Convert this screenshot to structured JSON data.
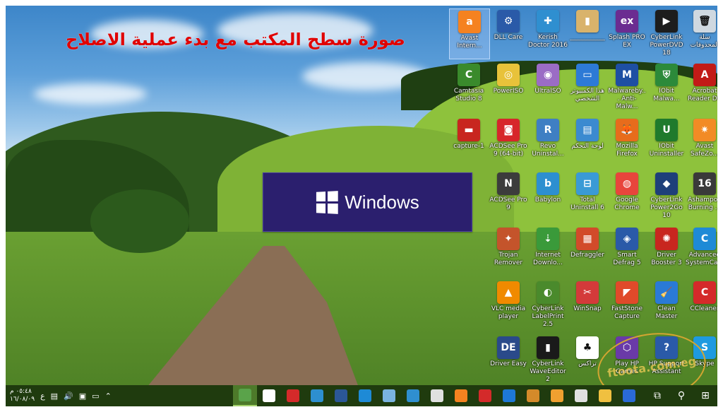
{
  "overlay_title": "صورة سطح المكتب مع بدء عملية الاصلاح",
  "banner": {
    "text": "Windows"
  },
  "desktop_icons": [
    {
      "label": "Avast Intern...",
      "color": "#f58220",
      "glyph": "a",
      "selected": true
    },
    {
      "label": "DLL Care",
      "color": "#2a5aa8",
      "glyph": "⚙"
    },
    {
      "label": "Kerish Doctor 2016",
      "color": "#2f8fd0",
      "glyph": "✚"
    },
    {
      "label": "___________",
      "color": "#d9b36b",
      "glyph": "▮"
    },
    {
      "label": "Splash PRO EX",
      "color": "#6b2c91",
      "glyph": "ex"
    },
    {
      "label": "CyberLink PowerDVD 18",
      "color": "#1d1d1d",
      "glyph": "▶"
    },
    {
      "label": "سلة المحذوفات",
      "color": "#cfd8e0",
      "glyph": "🗑"
    },
    {
      "label": "Camtasia Studio 8",
      "color": "#3a8a2c",
      "glyph": "C"
    },
    {
      "label": "PowerISO",
      "color": "#e8c23a",
      "glyph": "◎"
    },
    {
      "label": "UltraISO",
      "color": "#9b6cc5",
      "glyph": "◉"
    },
    {
      "label": "هذا الكمبيوتر الشخصي",
      "color": "#2d7ad6",
      "glyph": "▭"
    },
    {
      "label": "Malwareby... Anti-Malw...",
      "color": "#1e4fa3",
      "glyph": "M"
    },
    {
      "label": "IObit Malwa...",
      "color": "#2c8a3a",
      "glyph": "⛨"
    },
    {
      "label": "Acrobat Reader DC",
      "color": "#c21b17",
      "glyph": "A"
    },
    {
      "label": "capture-1",
      "color": "#c8261f",
      "glyph": "▬"
    },
    {
      "label": "ACDSee Pro 9 (64-bit)",
      "color": "#d7262b",
      "glyph": "◙"
    },
    {
      "label": "Revo Uninstal...",
      "color": "#3f7fc3",
      "glyph": "R"
    },
    {
      "label": "لوحة التحكم",
      "color": "#3b8ad0",
      "glyph": "▤"
    },
    {
      "label": "Mozilla Firefox",
      "color": "#e76c1c",
      "glyph": "🦊"
    },
    {
      "label": "IObit Uninstaller",
      "color": "#1f7a2c",
      "glyph": "U"
    },
    {
      "label": "Avast SafeZo...",
      "color": "#f28b25",
      "glyph": "✷"
    },
    {
      "label": "ACDSee Pro 9",
      "color": "#3c3c3c",
      "glyph": "N"
    },
    {
      "label": "Babylon",
      "color": "#2d8fd0",
      "glyph": "b"
    },
    {
      "label": "Total Uninstall 6",
      "color": "#3a9ad6",
      "glyph": "⊟"
    },
    {
      "label": "Google Chrome",
      "color": "#e8453c",
      "glyph": "◍"
    },
    {
      "label": "CyberLink Power2Go 10",
      "color": "#1e3f7a",
      "glyph": "◆"
    },
    {
      "label": "Ashampoo Burning ...",
      "color": "#3a3a3a",
      "glyph": "16"
    },
    {
      "label": "Trojan Remover",
      "color": "#c4542b",
      "glyph": "✦"
    },
    {
      "label": "Internet Downlo...",
      "color": "#3a9a3a",
      "glyph": "⇣"
    },
    {
      "label": "Defraggler",
      "color": "#d24b2a",
      "glyph": "▦"
    },
    {
      "label": "Smart Defrag 5",
      "color": "#2a5aa8",
      "glyph": "◈"
    },
    {
      "label": "Driver Booster 3",
      "color": "#c8261f",
      "glyph": "✺"
    },
    {
      "label": "Advanced SystemCa...",
      "color": "#1e8ad6",
      "glyph": "C"
    },
    {
      "label": "VLC media player",
      "color": "#f08a00",
      "glyph": "▲"
    },
    {
      "label": "CyberLink LabelPrint 2.5",
      "color": "#4a8a2c",
      "glyph": "◐"
    },
    {
      "label": "WinSnap",
      "color": "#d43a3a",
      "glyph": "✂"
    },
    {
      "label": "FastStone Capture",
      "color": "#e04a2a",
      "glyph": "◤"
    },
    {
      "label": "Clean Master",
      "color": "#2a7ad6",
      "glyph": "🧹"
    },
    {
      "label": "CCleaner",
      "color": "#d42a2a",
      "glyph": "C"
    },
    {
      "label": "Driver Easy",
      "color": "#2a4a8a",
      "glyph": "DE"
    },
    {
      "label": "CyberLink WaveEditor 2",
      "color": "#1a1a1a",
      "glyph": "▮"
    },
    {
      "label": "تراكس",
      "color": "#ffffff",
      "glyph": "♣"
    },
    {
      "label": "Play HP Games",
      "color": "#6a3aa8",
      "glyph": "⬡"
    },
    {
      "label": "HP Support Assistant",
      "color": "#2a5aa8",
      "glyph": "?"
    },
    {
      "label": "Skype",
      "color": "#1e9ae0",
      "glyph": "S"
    }
  ],
  "watermark": "ftoota.com.eg",
  "taskbar": {
    "clock_time": "٠٥:٤٨ م",
    "clock_date": "١٦/٠٨/٠٩",
    "lang": "ع",
    "tray_icons": [
      "notifications-icon",
      "volume-icon",
      "network-icon",
      "power-icon",
      "chevron-up-icon"
    ],
    "apps": [
      {
        "name": "desktop-active-app",
        "color": "#5aa34a",
        "active": true
      },
      {
        "name": "camtasia-app",
        "color": "#ffffff"
      },
      {
        "name": "recorder-app",
        "color": "#d42a2a"
      },
      {
        "name": "babylon-app",
        "color": "#2d8fd0"
      },
      {
        "name": "word-app",
        "color": "#2b5797"
      },
      {
        "name": "advanced-systemcare-app",
        "color": "#1e8ad6"
      },
      {
        "name": "folder-blue-app",
        "color": "#7ab3e0"
      },
      {
        "name": "kerish-app",
        "color": "#2f8fd0"
      },
      {
        "name": "ms-paint-app",
        "color": "#e0e0e0"
      },
      {
        "name": "avast-app",
        "color": "#f58220"
      },
      {
        "name": "snagit-app",
        "color": "#d42a2a"
      },
      {
        "name": "edge-app",
        "color": "#1e78d6"
      },
      {
        "name": "gallery-app",
        "color": "#d48a2a"
      },
      {
        "name": "media-app",
        "color": "#f0a030"
      },
      {
        "name": "store-app",
        "color": "#e0e0e0"
      },
      {
        "name": "explorer-app",
        "color": "#f0c040"
      },
      {
        "name": "media-player-app",
        "color": "#2a6ad6"
      }
    ],
    "right_icons": [
      {
        "name": "task-view-icon",
        "glyph": "⧉"
      },
      {
        "name": "search-icon",
        "glyph": "⚲"
      },
      {
        "name": "start-icon",
        "glyph": "⊞"
      }
    ]
  }
}
